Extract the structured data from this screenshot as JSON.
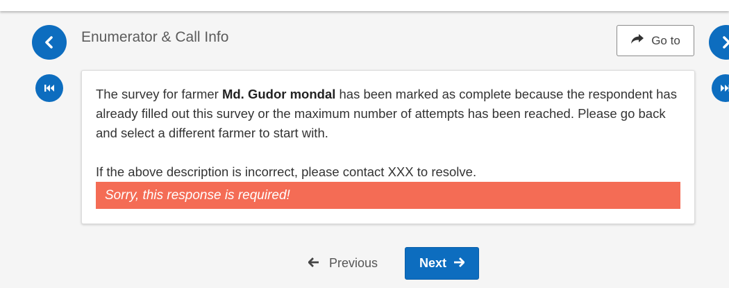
{
  "section": {
    "title": "Enumerator & Call Info"
  },
  "nav": {
    "goto_label": "Go to",
    "previous_label": "Previous",
    "next_label": "Next"
  },
  "message": {
    "before_name": "The survey for farmer ",
    "farmer_name": "Md. Gudor mondal",
    "after_name": " has been marked as complete because the respondent has already filled out this survey or the maximum number of attempts has been reached. Please go back and select a different farmer to start with.",
    "contact_text": "If the above description is incorrect, please contact XXX to resolve."
  },
  "error": {
    "text": "Sorry, this response is required!"
  },
  "colors": {
    "primary": "#0d6dbf",
    "error": "#f46c55",
    "background": "#f5f5f5"
  },
  "icons": {
    "back": "chevron-left-icon",
    "forward": "chevron-right-icon",
    "first": "skip-to-start-icon",
    "last": "skip-to-end-icon",
    "goto": "share-arrow-icon",
    "previous": "arrow-left-icon",
    "next": "arrow-right-icon"
  }
}
